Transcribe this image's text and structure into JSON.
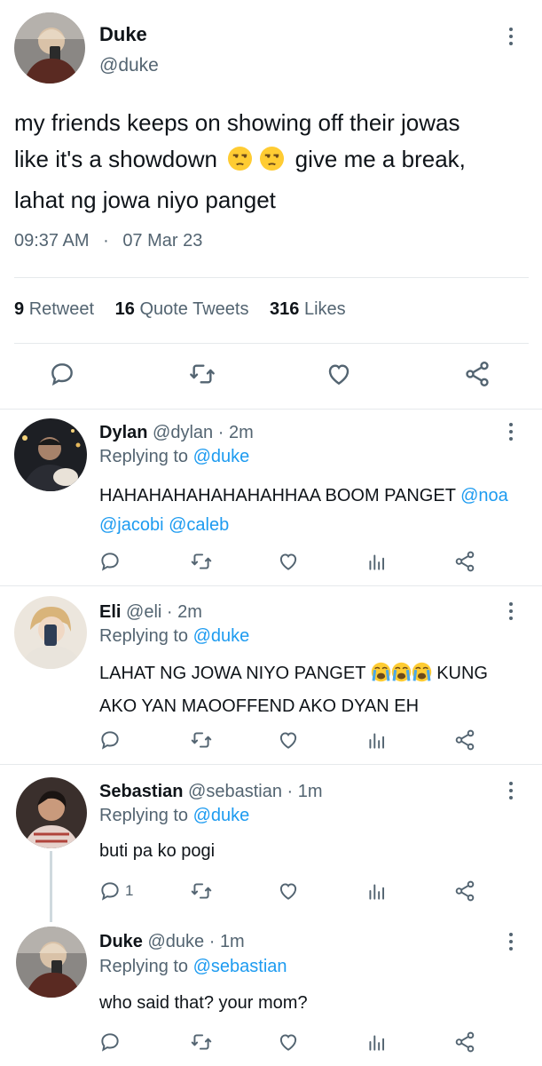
{
  "main_tweet": {
    "name": "Duke",
    "handle": "@duke",
    "text_lines": [
      "my friends keeps on showing off their jowas",
      "like it's a showdown",
      "give me a break,",
      "lahat ng jowa niyo panget"
    ],
    "time": "09:37 AM",
    "dot": "·",
    "date": "07 Mar 23",
    "stats": {
      "retweets_count": "9",
      "retweets_label": "Retweet",
      "quotes_count": "16",
      "quotes_label": "Quote Tweets",
      "likes_count": "316",
      "likes_label": "Likes"
    }
  },
  "replies": [
    {
      "name": "Dylan",
      "handle": "@dylan",
      "sep": "·",
      "time": "2m",
      "replying_prefix": "Replying to",
      "replying_to": "@duke",
      "line1_text": "HAHAHAHAHAHAHAHHAA BOOM PANGET",
      "line1_mention": "@noa",
      "line2_m1": "@jacobi",
      "line2_m2": "@caleb"
    },
    {
      "name": "Eli",
      "handle": "@eli",
      "sep": "·",
      "time": "2m",
      "replying_prefix": "Replying to",
      "replying_to": "@duke",
      "line1_text": "LAHAT NG JOWA NIYO PANGET",
      "line1_after": "KUNG",
      "line2": "AKO YAN MAOOFFEND AKO DYAN EH"
    },
    {
      "name": "Sebastian",
      "handle": "@sebastian",
      "sep": "·",
      "time": "1m",
      "replying_prefix": "Replying to",
      "replying_to": "@duke",
      "text": "buti pa ko pogi",
      "reply_count": "1"
    },
    {
      "name": "Duke",
      "handle": "@duke",
      "sep": "·",
      "time": "1m",
      "replying_prefix": "Replying to",
      "replying_to": "@sebastian",
      "text": "who said that? your mom?"
    }
  ],
  "icons": {
    "reply": "reply-icon",
    "retweet": "retweet-icon",
    "like": "heart-icon",
    "views": "analytics-icon",
    "share": "share-icon",
    "more": "more-vertical-icon",
    "emoji_unamused": "unamused-face-emoji",
    "emoji_crying": "loudly-crying-face-emoji"
  },
  "colors": {
    "text": "#0f1419",
    "secondary": "#536471",
    "link": "#1d9bf0",
    "divider": "#e6e9ec",
    "emoji": "#ffcc33"
  }
}
